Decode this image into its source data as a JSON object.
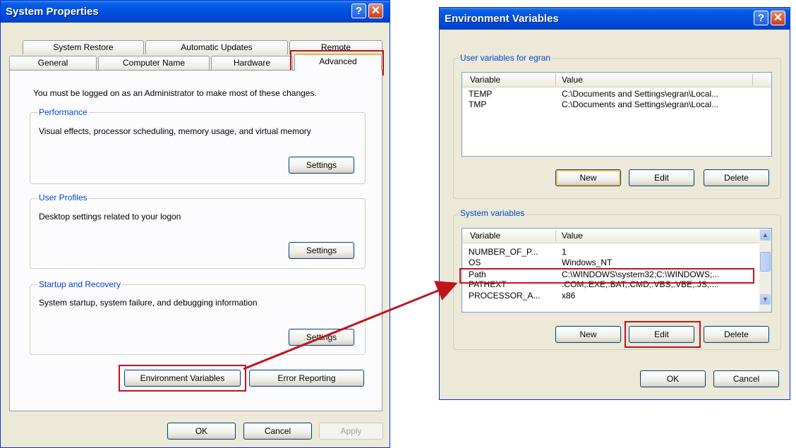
{
  "system_properties": {
    "title": "System Properties",
    "help_glyph": "?",
    "close_glyph": "✕",
    "tabs_row1": [
      "System Restore",
      "Automatic Updates",
      "Remote"
    ],
    "tabs_row2": [
      "General",
      "Computer Name",
      "Hardware",
      "Advanced"
    ],
    "notice": "You must be logged on as an Administrator to make most of these changes.",
    "performance": {
      "label": "Performance",
      "description": "Visual effects, processor scheduling, memory usage, and virtual memory",
      "settings_label": "Settings"
    },
    "user_profiles": {
      "label": "User Profiles",
      "description": "Desktop settings related to your logon",
      "settings_label": "Settings"
    },
    "startup_recovery": {
      "label": "Startup and Recovery",
      "description": "System startup, system failure, and debugging information",
      "settings_label": "Settings"
    },
    "env_vars_label": "Environment Variables",
    "error_reporting_label": "Error Reporting",
    "ok_label": "OK",
    "cancel_label": "Cancel",
    "apply_label": "Apply"
  },
  "environment_variables": {
    "title": "Environment Variables",
    "help_glyph": "?",
    "close_glyph": "✕",
    "user_group_label": "User variables for egran",
    "system_group_label": "System variables",
    "columns": [
      "Variable",
      "Value"
    ],
    "user_rows": [
      {
        "variable": "TEMP",
        "value": "C:\\Documents and Settings\\egran\\Local..."
      },
      {
        "variable": "TMP",
        "value": "C:\\Documents and Settings\\egran\\Local..."
      }
    ],
    "system_rows": [
      {
        "variable": "NUMBER_OF_P...",
        "value": "1"
      },
      {
        "variable": "OS",
        "value": "Windows_NT"
      },
      {
        "variable": "Path",
        "value": "C:\\WINDOWS\\system32;C:\\WINDOWS;..."
      },
      {
        "variable": "PATHEXT",
        "value": ".COM;.EXE;.BAT;.CMD;.VBS;.VBE;.JS;...."
      },
      {
        "variable": "PROCESSOR_A...",
        "value": "x86"
      }
    ],
    "new_label": "New",
    "edit_label": "Edit",
    "delete_label": "Delete",
    "ok_label": "OK",
    "cancel_label": "Cancel"
  },
  "highlight_color": "#c0141b",
  "title_bar_color": "#0054e3"
}
